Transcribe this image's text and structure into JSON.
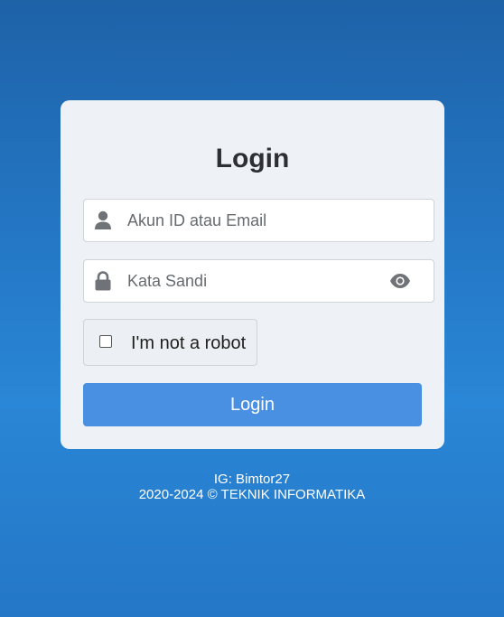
{
  "login_card": {
    "title": "Login",
    "username": {
      "placeholder": "Akun ID atau Email",
      "value": "",
      "icon": "user-icon"
    },
    "password": {
      "placeholder": "Kata Sandi",
      "value": "",
      "icon": "lock-icon",
      "toggle_icon": "eye-icon"
    },
    "captcha": {
      "label": "I'm not a robot",
      "checked": false
    },
    "submit_label": "Login"
  },
  "footer": {
    "line1": "IG: Bimtor27",
    "line2": "2020-2024 © TEKNIK INFORMATIKA"
  },
  "colors": {
    "background": "#2478c6",
    "card": "#eef2f7",
    "button": "#4a90e2",
    "icon": "#6f7377"
  }
}
